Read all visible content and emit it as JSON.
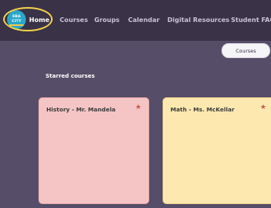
{
  "nav": {
    "logo_line1": "SBA",
    "logo_line2": "CITY",
    "items": [
      {
        "label": "Home"
      },
      {
        "label": "Courses"
      },
      {
        "label": "Groups"
      },
      {
        "label": "Calendar"
      },
      {
        "label": "Digital Resources"
      },
      {
        "label": "Student FAQ"
      }
    ]
  },
  "toolbar": {
    "courses_label": "Courses"
  },
  "starred": {
    "title": "Starred courses",
    "courses": [
      {
        "name": "History - Mr. Mandela",
        "color": "#f5c4c4"
      },
      {
        "name": "Math - Ms. McKellar",
        "color": "#fde9b0"
      }
    ]
  },
  "colors": {
    "nav_bg": "#3a3247",
    "page_bg": "#564d68",
    "highlight_ring": "#f2d24a",
    "star": "#c85b50"
  },
  "icons": {
    "star": "★"
  }
}
